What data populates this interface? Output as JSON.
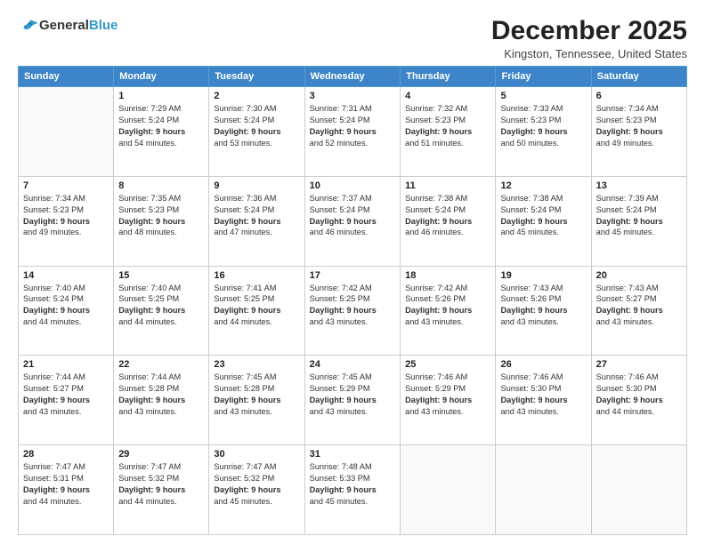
{
  "header": {
    "logo_general": "General",
    "logo_blue": "Blue",
    "month_title": "December 2025",
    "location": "Kingston, Tennessee, United States"
  },
  "days_of_week": [
    "Sunday",
    "Monday",
    "Tuesday",
    "Wednesday",
    "Thursday",
    "Friday",
    "Saturday"
  ],
  "weeks": [
    [
      {
        "day": "",
        "info": ""
      },
      {
        "day": "1",
        "info": "Sunrise: 7:29 AM\nSunset: 5:24 PM\nDaylight: 9 hours\nand 54 minutes."
      },
      {
        "day": "2",
        "info": "Sunrise: 7:30 AM\nSunset: 5:24 PM\nDaylight: 9 hours\nand 53 minutes."
      },
      {
        "day": "3",
        "info": "Sunrise: 7:31 AM\nSunset: 5:24 PM\nDaylight: 9 hours\nand 52 minutes."
      },
      {
        "day": "4",
        "info": "Sunrise: 7:32 AM\nSunset: 5:23 PM\nDaylight: 9 hours\nand 51 minutes."
      },
      {
        "day": "5",
        "info": "Sunrise: 7:33 AM\nSunset: 5:23 PM\nDaylight: 9 hours\nand 50 minutes."
      },
      {
        "day": "6",
        "info": "Sunrise: 7:34 AM\nSunset: 5:23 PM\nDaylight: 9 hours\nand 49 minutes."
      }
    ],
    [
      {
        "day": "7",
        "info": "Sunrise: 7:34 AM\nSunset: 5:23 PM\nDaylight: 9 hours\nand 49 minutes."
      },
      {
        "day": "8",
        "info": "Sunrise: 7:35 AM\nSunset: 5:23 PM\nDaylight: 9 hours\nand 48 minutes."
      },
      {
        "day": "9",
        "info": "Sunrise: 7:36 AM\nSunset: 5:24 PM\nDaylight: 9 hours\nand 47 minutes."
      },
      {
        "day": "10",
        "info": "Sunrise: 7:37 AM\nSunset: 5:24 PM\nDaylight: 9 hours\nand 46 minutes."
      },
      {
        "day": "11",
        "info": "Sunrise: 7:38 AM\nSunset: 5:24 PM\nDaylight: 9 hours\nand 46 minutes."
      },
      {
        "day": "12",
        "info": "Sunrise: 7:38 AM\nSunset: 5:24 PM\nDaylight: 9 hours\nand 45 minutes."
      },
      {
        "day": "13",
        "info": "Sunrise: 7:39 AM\nSunset: 5:24 PM\nDaylight: 9 hours\nand 45 minutes."
      }
    ],
    [
      {
        "day": "14",
        "info": "Sunrise: 7:40 AM\nSunset: 5:24 PM\nDaylight: 9 hours\nand 44 minutes."
      },
      {
        "day": "15",
        "info": "Sunrise: 7:40 AM\nSunset: 5:25 PM\nDaylight: 9 hours\nand 44 minutes."
      },
      {
        "day": "16",
        "info": "Sunrise: 7:41 AM\nSunset: 5:25 PM\nDaylight: 9 hours\nand 44 minutes."
      },
      {
        "day": "17",
        "info": "Sunrise: 7:42 AM\nSunset: 5:25 PM\nDaylight: 9 hours\nand 43 minutes."
      },
      {
        "day": "18",
        "info": "Sunrise: 7:42 AM\nSunset: 5:26 PM\nDaylight: 9 hours\nand 43 minutes."
      },
      {
        "day": "19",
        "info": "Sunrise: 7:43 AM\nSunset: 5:26 PM\nDaylight: 9 hours\nand 43 minutes."
      },
      {
        "day": "20",
        "info": "Sunrise: 7:43 AM\nSunset: 5:27 PM\nDaylight: 9 hours\nand 43 minutes."
      }
    ],
    [
      {
        "day": "21",
        "info": "Sunrise: 7:44 AM\nSunset: 5:27 PM\nDaylight: 9 hours\nand 43 minutes."
      },
      {
        "day": "22",
        "info": "Sunrise: 7:44 AM\nSunset: 5:28 PM\nDaylight: 9 hours\nand 43 minutes."
      },
      {
        "day": "23",
        "info": "Sunrise: 7:45 AM\nSunset: 5:28 PM\nDaylight: 9 hours\nand 43 minutes."
      },
      {
        "day": "24",
        "info": "Sunrise: 7:45 AM\nSunset: 5:29 PM\nDaylight: 9 hours\nand 43 minutes."
      },
      {
        "day": "25",
        "info": "Sunrise: 7:46 AM\nSunset: 5:29 PM\nDaylight: 9 hours\nand 43 minutes."
      },
      {
        "day": "26",
        "info": "Sunrise: 7:46 AM\nSunset: 5:30 PM\nDaylight: 9 hours\nand 43 minutes."
      },
      {
        "day": "27",
        "info": "Sunrise: 7:46 AM\nSunset: 5:30 PM\nDaylight: 9 hours\nand 44 minutes."
      }
    ],
    [
      {
        "day": "28",
        "info": "Sunrise: 7:47 AM\nSunset: 5:31 PM\nDaylight: 9 hours\nand 44 minutes."
      },
      {
        "day": "29",
        "info": "Sunrise: 7:47 AM\nSunset: 5:32 PM\nDaylight: 9 hours\nand 44 minutes."
      },
      {
        "day": "30",
        "info": "Sunrise: 7:47 AM\nSunset: 5:32 PM\nDaylight: 9 hours\nand 45 minutes."
      },
      {
        "day": "31",
        "info": "Sunrise: 7:48 AM\nSunset: 5:33 PM\nDaylight: 9 hours\nand 45 minutes."
      },
      {
        "day": "",
        "info": ""
      },
      {
        "day": "",
        "info": ""
      },
      {
        "day": "",
        "info": ""
      }
    ]
  ]
}
